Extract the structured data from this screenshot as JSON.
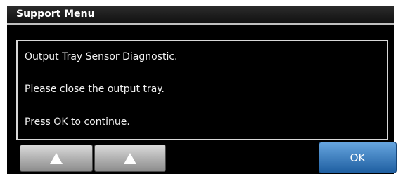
{
  "window": {
    "title": "Support Menu"
  },
  "message": {
    "lines": [
      "Output Tray Sensor Diagnostic.",
      "Please close the output tray.",
      "Press OK to continue."
    ]
  },
  "controls": {
    "ok_label": "OK",
    "arrow_icon": "up-arrow-icon"
  },
  "colors": {
    "background": "#000000",
    "ok_button": "#3f85c7",
    "arrow_button": "#b3b3b3"
  }
}
